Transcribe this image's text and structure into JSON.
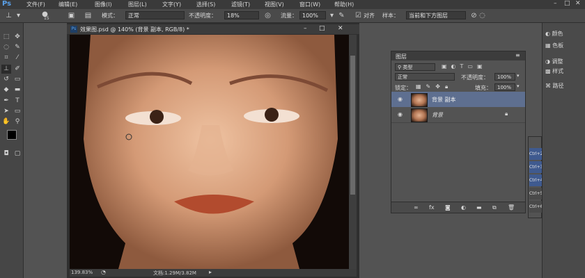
{
  "app": {
    "logo": "Ps",
    "menu": [
      "文件(F)",
      "编辑(E)",
      "图像(I)",
      "图层(L)",
      "文字(Y)",
      "选择(S)",
      "滤镜(T)",
      "视图(V)",
      "窗口(W)",
      "帮助(H)"
    ],
    "window_controls": [
      "–",
      "□",
      "✕"
    ]
  },
  "options_bar": {
    "brush_size": "15",
    "mode_label": "模式：",
    "mode_value": "正常",
    "opacity_label": "不透明度：",
    "opacity_value": "18%",
    "flow_label": "流量：",
    "flow_value": "100%",
    "align_label": "对齐",
    "sample_label": "样本：",
    "sample_value": "当前和下方图层"
  },
  "document": {
    "tab_title": "效果图.psd @ 140% (背景 副本, RGB/8) *",
    "zoom": "139.83%",
    "doc_info": "文档:1.29M/3.82M",
    "controls": [
      "–",
      "□",
      "✕"
    ]
  },
  "layers_panel": {
    "title": "图层",
    "filter_label": "类型",
    "blend_mode": "正常",
    "opacity_label": "不透明度：",
    "opacity_value": "100%",
    "lock_label": "锁定：",
    "fill_label": "填充：",
    "fill_value": "100%",
    "layers": [
      {
        "name": "背景 副本",
        "selected": true
      },
      {
        "name": "背景",
        "selected": false
      }
    ],
    "footer_icons": [
      "link-icon",
      "fx-icon",
      "mask-icon",
      "adjustment-icon",
      "group-icon",
      "new-layer-icon",
      "trash-icon"
    ]
  },
  "right_panels": {
    "items": [
      "颜色",
      "色板",
      "调整",
      "样式",
      "路径"
    ]
  },
  "actions_panel": {
    "shortcuts": [
      "Ctrl+2",
      "Ctrl+3",
      "Ctrl+4",
      "Ctrl+5",
      "Ctrl+6"
    ]
  },
  "colors": {
    "foreground": "#000000",
    "background": "#ffffff",
    "selection": "#5e6f90",
    "ps_blue": "#5aa0e8"
  }
}
